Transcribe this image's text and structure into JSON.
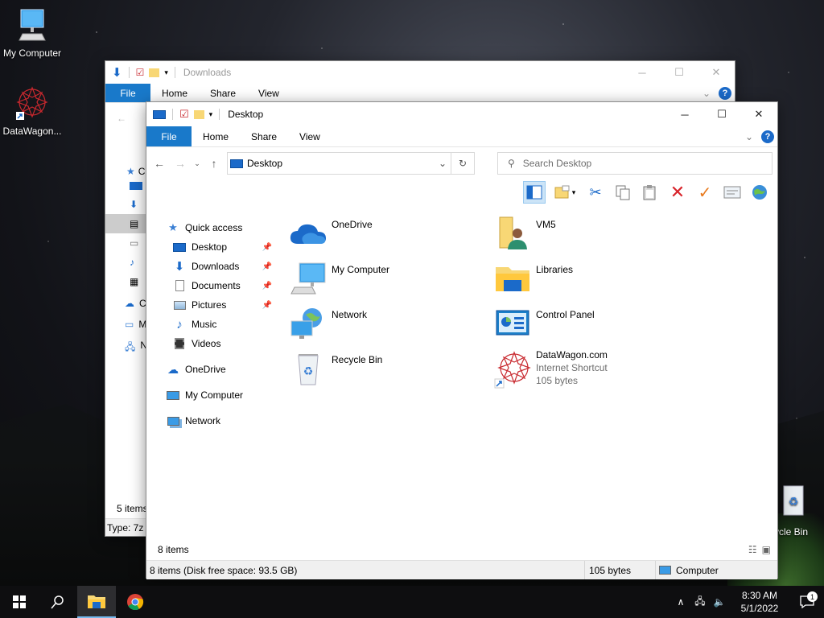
{
  "desktop": {
    "icons": [
      {
        "label": "My Computer"
      },
      {
        "label": "DataWagon..."
      },
      {
        "label": "ycle Bin"
      }
    ]
  },
  "back_window": {
    "title": "Downloads",
    "ribbon": {
      "file": "File",
      "home": "Home",
      "share": "Share",
      "view": "View"
    },
    "nav_partial": [
      "C",
      "C",
      "M",
      "N"
    ],
    "items_count": "5 items",
    "status": "Type: 7z A"
  },
  "window": {
    "title": "Desktop",
    "controls": {
      "minimize": "─",
      "maximize": "☐",
      "close": "✕"
    },
    "ribbon": {
      "file": "File",
      "home": "Home",
      "share": "Share",
      "view": "View",
      "help": "?"
    },
    "address": {
      "path": "Desktop"
    },
    "search": {
      "placeholder": "Search Desktop"
    },
    "nav": {
      "quick_access": "Quick access",
      "quick_items": [
        "Desktop",
        "Downloads",
        "Documents",
        "Pictures",
        "Music",
        "Videos"
      ],
      "onedrive": "OneDrive",
      "my_computer": "My Computer",
      "network": "Network"
    },
    "files": [
      {
        "name": "OneDrive",
        "icon": "onedrive-icon"
      },
      {
        "name": "VM5",
        "icon": "user-folder-icon"
      },
      {
        "name": "My Computer",
        "icon": "computer-icon"
      },
      {
        "name": "Libraries",
        "icon": "libraries-icon"
      },
      {
        "name": "Network",
        "icon": "network-icon"
      },
      {
        "name": "Control Panel",
        "icon": "control-panel-icon"
      },
      {
        "name": "Recycle Bin",
        "icon": "recycle-bin-icon"
      },
      {
        "name": "DataWagon.com",
        "type": "Internet Shortcut",
        "size": "105 bytes",
        "icon": "datawagon-shortcut-icon"
      }
    ],
    "items_count": "8 items",
    "status": {
      "summary": "8 items (Disk free space: 93.5 GB)",
      "size": "105 bytes",
      "location": "Computer"
    }
  },
  "taskbar": {
    "time": "8:30 AM",
    "date": "5/1/2022",
    "notifications": "1"
  },
  "colors": {
    "accent": "#1979ca",
    "folder": "#f8d775"
  }
}
